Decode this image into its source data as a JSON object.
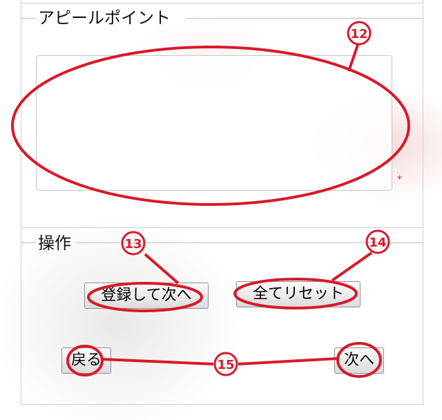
{
  "appeal_section": {
    "legend": "アピールポイント",
    "textarea_value": "",
    "required_mark": "*"
  },
  "operation_section": {
    "legend": "操作",
    "register_next_label": "登録して次へ",
    "reset_all_label": "全てリセット",
    "back_label": "戻る",
    "next_label": "次へ"
  },
  "annotations": {
    "badge_12": "12",
    "badge_13": "13",
    "badge_14": "14",
    "badge_15": "15",
    "color": "#d7192a"
  }
}
